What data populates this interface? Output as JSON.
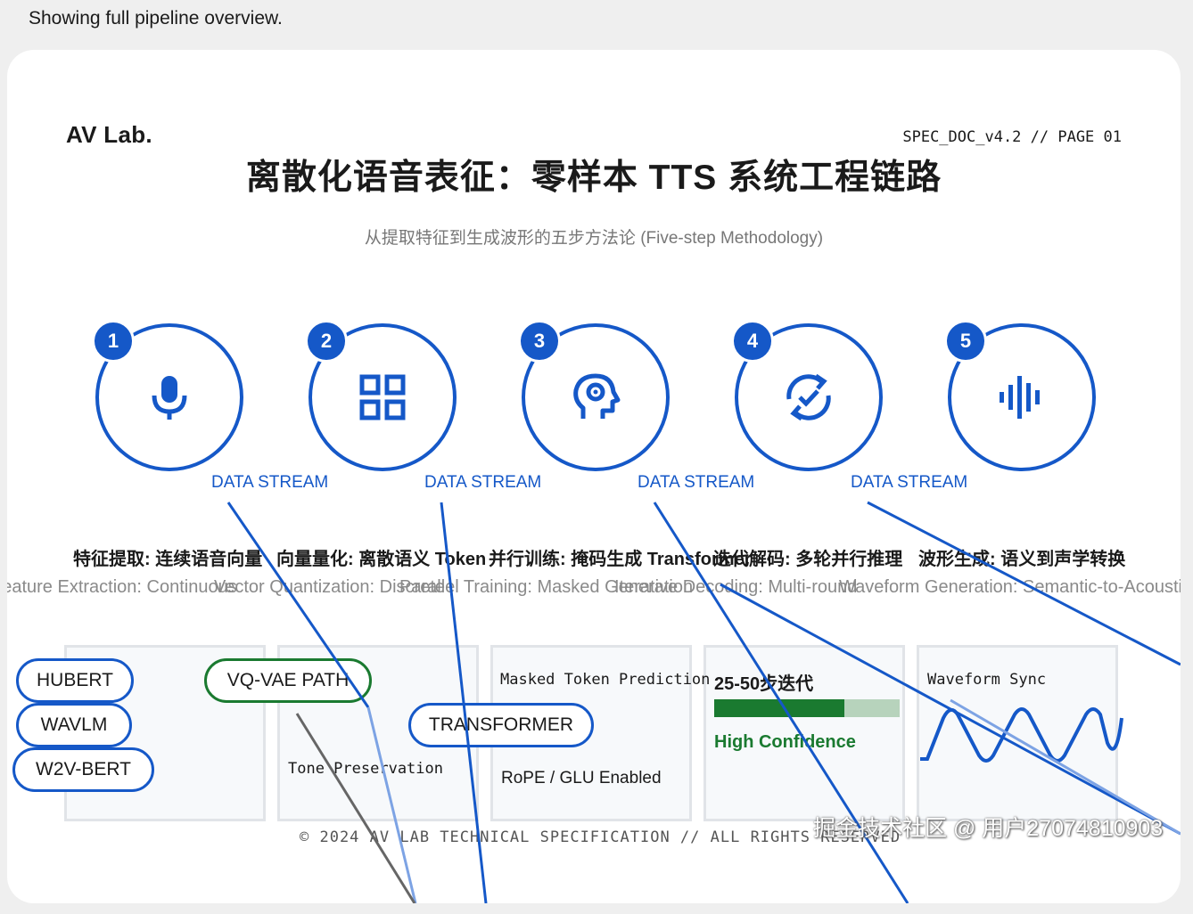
{
  "status_text": "Showing full pipeline overview.",
  "header": {
    "logo": "AV Lab.",
    "spec": "SPEC_DOC_v4.2 // PAGE 01",
    "title": "离散化语音表征：零样本 TTS 系统工程链路",
    "subtitle": "从提取特征到生成波形的五步方法论 (Five-step Methodology)"
  },
  "steps": [
    {
      "number": "1",
      "icon": "microphone-icon",
      "stream": "DATA STREAM",
      "label_cn": "特征提取: 连续语音向量",
      "label_en": "Feature Extraction: Continuous"
    },
    {
      "number": "2",
      "icon": "grid-icon",
      "stream": "DATA STREAM",
      "label_cn": "向量量化: 离散语义 Token",
      "label_en": "Vector Quantization: Discrete"
    },
    {
      "number": "3",
      "icon": "brain-gear-icon",
      "stream": "DATA STREAM",
      "label_cn": "并行训练: 掩码生成 Transformer",
      "label_en": "Parallel Training: Masked Generation"
    },
    {
      "number": "4",
      "icon": "sync-check-icon",
      "stream": "DATA STREAM",
      "label_cn": "迭代解码: 多轮并行推理",
      "label_en": "Iterative Decoding: Multi-round"
    },
    {
      "number": "5",
      "icon": "waveform-icon",
      "stream": "",
      "label_cn": "波形生成: 语义到声学转换",
      "label_en": "Waveform Generation: Semantic-to-Acoustic"
    }
  ],
  "extra_stream_label": "DATA STREAM",
  "panels": {
    "p1": {
      "pills": [
        "HUBERT",
        "WAVLM",
        "W2V-BERT"
      ]
    },
    "p2": {
      "pill": "VQ-VAE PATH",
      "note": "Tone Preservation"
    },
    "p3": {
      "mono": "Masked Token Prediction",
      "pill": "TRANSFORMER",
      "note": "RoPE / GLU Enabled"
    },
    "p4": {
      "heading": "25-50步迭代",
      "progress": 0.7,
      "confidence": "High Confidence"
    },
    "p5": {
      "mono": "Waveform Sync"
    }
  },
  "footer": "© 2024 AV LAB TECHNICAL SPECIFICATION // ALL RIGHTS RESERVED",
  "watermark": "掘金技术社区 @ 用户27074810903",
  "colors": {
    "accent": "#1558c8",
    "green": "#1a7a30",
    "panel_bg": "#f7f9fb"
  }
}
